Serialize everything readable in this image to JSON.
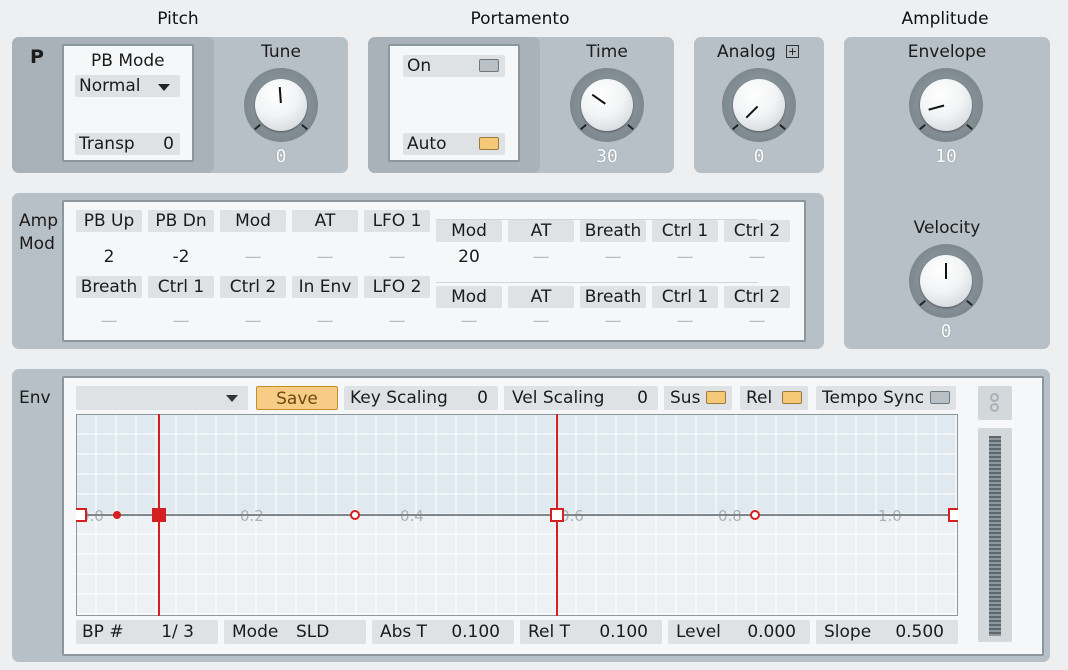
{
  "headers": {
    "pitch": "Pitch",
    "portamento": "Portamento",
    "amplitude": "Amplitude"
  },
  "pitch": {
    "p_label": "P",
    "pb_mode_label": "PB Mode",
    "pb_mode_value": "Normal",
    "transp_label": "Transp",
    "transp_value": "0",
    "tune_label": "Tune",
    "tune_value": "0"
  },
  "portamento": {
    "on_label": "On",
    "auto_label": "Auto",
    "time_label": "Time",
    "time_value": "30"
  },
  "analog": {
    "label": "Analog",
    "value": "0"
  },
  "amplitude": {
    "envelope_label": "Envelope",
    "envelope_value": "10",
    "velocity_label": "Velocity",
    "velocity_value": "0"
  },
  "ampmod": {
    "label_line1": "Amp",
    "label_line2": "Mod",
    "row1": [
      {
        "label": "PB Up",
        "value": "2"
      },
      {
        "label": "PB Dn",
        "value": "-2"
      },
      {
        "label": "Mod",
        "value": "—"
      },
      {
        "label": "AT",
        "value": "—"
      },
      {
        "label": "LFO 1",
        "value": "—"
      }
    ],
    "row1b": [
      {
        "label": "Mod",
        "value": "20"
      },
      {
        "label": "AT",
        "value": "—"
      },
      {
        "label": "Breath",
        "value": "—"
      },
      {
        "label": "Ctrl 1",
        "value": "—"
      },
      {
        "label": "Ctrl 2",
        "value": "—"
      }
    ],
    "row2": [
      {
        "label": "Breath",
        "value": "—"
      },
      {
        "label": "Ctrl 1",
        "value": "—"
      },
      {
        "label": "Ctrl 2",
        "value": "—"
      },
      {
        "label": "In Env",
        "value": "—"
      },
      {
        "label": "LFO 2",
        "value": "—"
      }
    ],
    "row2b": [
      {
        "label": "Mod",
        "value": "—"
      },
      {
        "label": "AT",
        "value": "—"
      },
      {
        "label": "Breath",
        "value": "—"
      },
      {
        "label": "Ctrl 1",
        "value": "—"
      },
      {
        "label": "Ctrl 2",
        "value": "—"
      }
    ]
  },
  "env": {
    "label": "Env",
    "preset_value": "",
    "save_label": "Save",
    "key_scaling_label": "Key Scaling",
    "key_scaling_value": "0",
    "vel_scaling_label": "Vel Scaling",
    "vel_scaling_value": "0",
    "sus_label": "Sus",
    "rel_label": "Rel",
    "tempo_sync_label": "Tempo Sync",
    "axis_labels": [
      "0.0",
      "0.2",
      "0.4",
      "0.6",
      "0.8",
      "1.0"
    ],
    "bp_label": "BP #",
    "bp_value": "1/ 3",
    "mode_label": "Mode",
    "mode_value": "SLD",
    "abst_label": "Abs T",
    "abst_value": "0.100",
    "relt_label": "Rel T",
    "relt_value": "0.100",
    "level_label": "Level",
    "level_value": "0.000",
    "slope_label": "Slope",
    "slope_value": "0.500"
  },
  "colors": {
    "accent": "#d42020",
    "led_on": "#f5c978",
    "panel": "#b7c0c6"
  }
}
